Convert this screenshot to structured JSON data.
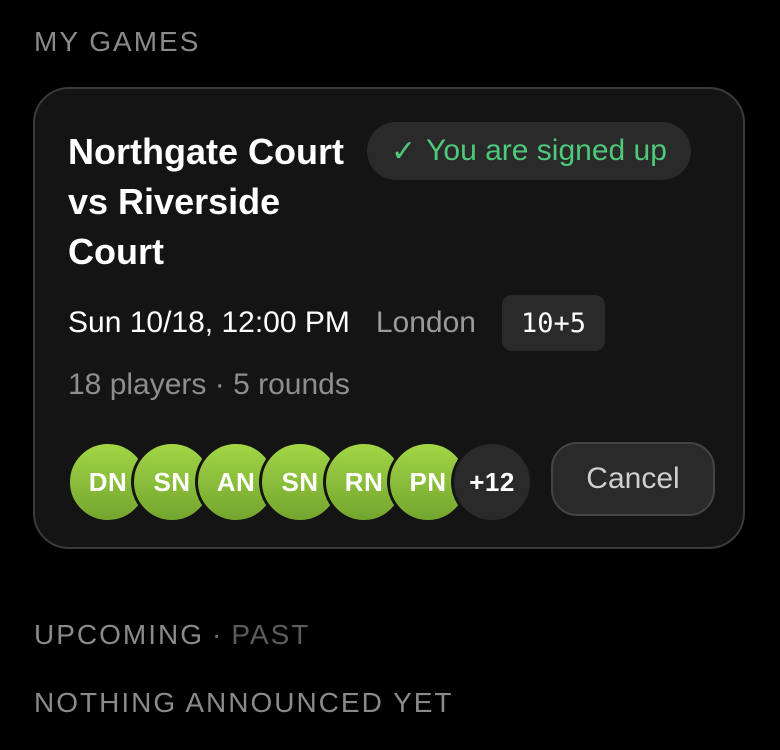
{
  "my_games": {
    "section_title": "MY GAMES",
    "card": {
      "title": "Northgate Court vs Riverside Court",
      "signup_badge": {
        "check_icon": "✓",
        "label": "You are signed up",
        "color": "#4ec97a"
      },
      "datetime": "Sun 10/18, 12:00 PM",
      "location": "London",
      "time_control": "10+5",
      "stats": "18 players · 5 rounds",
      "avatars": [
        "DN",
        "SN",
        "AN",
        "SN",
        "RN",
        "PN"
      ],
      "more_count": "+12",
      "cancel_label": "Cancel"
    }
  },
  "tabs": {
    "upcoming": "UPCOMING",
    "separator": "·",
    "past": "PAST"
  },
  "empty_state": "NOTHING ANNOUNCED YET",
  "colors": {
    "background": "#000000",
    "card": "#141414",
    "avatar_green": "#8fc23c",
    "accent_green": "#4ec97a"
  }
}
